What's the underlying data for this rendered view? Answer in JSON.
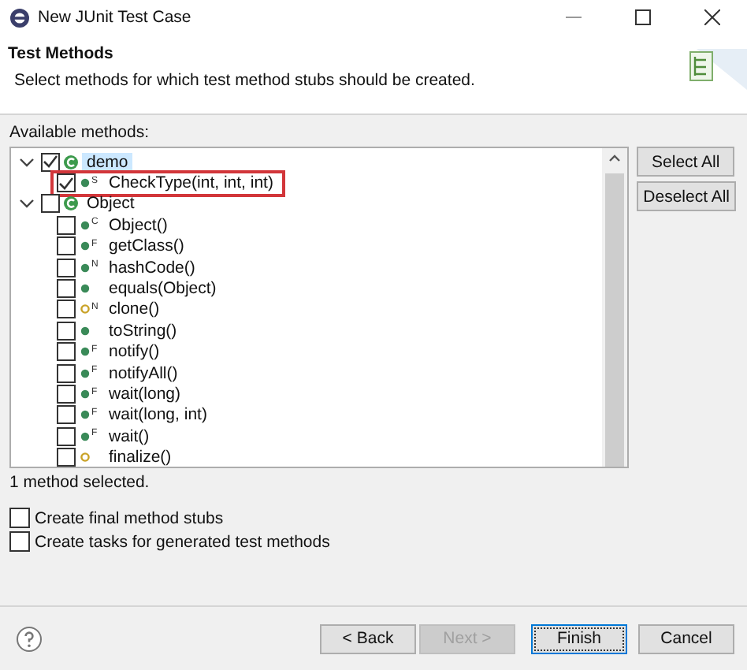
{
  "window": {
    "title": "New JUnit Test Case"
  },
  "header": {
    "title": "Test Methods",
    "description": "Select methods for which test method stubs should be created."
  },
  "methods_label": "Available methods:",
  "tree": [
    {
      "label": "demo",
      "kind": "class",
      "checked": true,
      "expanded": true,
      "selected": true,
      "children": [
        {
          "label": "CheckType(int, int, int)",
          "kind": "method",
          "protected": false,
          "badge": "S",
          "checked": true,
          "selected": false,
          "highlighted": true
        }
      ]
    },
    {
      "label": "Object",
      "kind": "class",
      "checked": false,
      "expanded": true,
      "selected": false,
      "children": [
        {
          "label": "Object()",
          "kind": "method",
          "protected": false,
          "badge": "C",
          "checked": false,
          "selected": false,
          "highlighted": false
        },
        {
          "label": "getClass()",
          "kind": "method",
          "protected": false,
          "badge": "F",
          "checked": false,
          "selected": false,
          "highlighted": false
        },
        {
          "label": "hashCode()",
          "kind": "method",
          "protected": false,
          "badge": "N",
          "checked": false,
          "selected": false,
          "highlighted": false
        },
        {
          "label": "equals(Object)",
          "kind": "method",
          "protected": false,
          "checked": false,
          "selected": false,
          "highlighted": false
        },
        {
          "label": "clone()",
          "kind": "method",
          "protected": true,
          "badge": "N",
          "checked": false,
          "selected": false,
          "highlighted": false
        },
        {
          "label": "toString()",
          "kind": "method",
          "protected": false,
          "checked": false,
          "selected": false,
          "highlighted": false
        },
        {
          "label": "notify()",
          "kind": "method",
          "protected": false,
          "badge": "F",
          "checked": false,
          "selected": false,
          "highlighted": false
        },
        {
          "label": "notifyAll()",
          "kind": "method",
          "protected": false,
          "badge": "F",
          "checked": false,
          "selected": false,
          "highlighted": false
        },
        {
          "label": "wait(long)",
          "kind": "method",
          "protected": false,
          "badge": "F",
          "checked": false,
          "selected": false,
          "highlighted": false
        },
        {
          "label": "wait(long, int)",
          "kind": "method",
          "protected": false,
          "badge": "F",
          "checked": false,
          "selected": false,
          "highlighted": false
        },
        {
          "label": "wait()",
          "kind": "method",
          "protected": false,
          "badge": "F",
          "checked": false,
          "selected": false,
          "highlighted": false
        },
        {
          "label": "finalize()",
          "kind": "method",
          "protected": true,
          "checked": false,
          "selected": false,
          "highlighted": false
        }
      ]
    }
  ],
  "side_buttons": [
    "Select All",
    "Deselect All"
  ],
  "status": "1 method selected.",
  "options": [
    {
      "label": "Create final method stubs",
      "checked": false
    },
    {
      "label": "Create tasks for generated test methods",
      "checked": false
    }
  ],
  "buttons": [
    {
      "label": "< Back",
      "disabled": false,
      "default": false
    },
    {
      "label": "Next >",
      "disabled": true,
      "default": false
    },
    {
      "label": "Finish",
      "disabled": false,
      "default": true
    },
    {
      "label": "Cancel",
      "disabled": false,
      "default": false
    }
  ]
}
